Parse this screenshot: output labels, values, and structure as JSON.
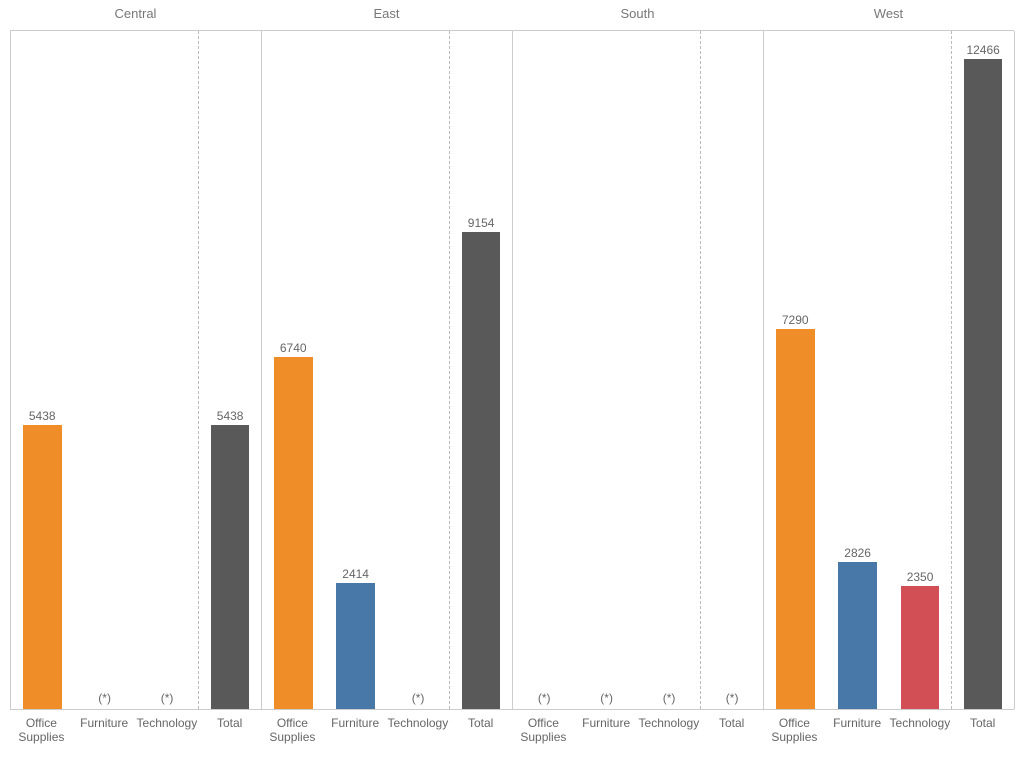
{
  "chart_data": {
    "type": "bar",
    "ylim": [
      0,
      13000
    ],
    "suppressed_marker": "(*)",
    "category_order": [
      "Office Supplies",
      "Furniture",
      "Technology"
    ],
    "total_label": "Total",
    "colors": {
      "Office Supplies": "#ef8e28",
      "Furniture": "#4878a7",
      "Technology": "#d14f55",
      "Total": "#595959"
    },
    "panels": [
      {
        "name": "Central",
        "bars": {
          "Office Supplies": 5438,
          "Furniture": null,
          "Technology": null
        },
        "total": 5438
      },
      {
        "name": "East",
        "bars": {
          "Office Supplies": 6740,
          "Furniture": 2414,
          "Technology": null
        },
        "total": 9154
      },
      {
        "name": "South",
        "bars": {
          "Office Supplies": null,
          "Furniture": null,
          "Technology": null
        },
        "total": null
      },
      {
        "name": "West",
        "bars": {
          "Office Supplies": 7290,
          "Furniture": 2826,
          "Technology": 2350
        },
        "total": 12466
      }
    ]
  }
}
